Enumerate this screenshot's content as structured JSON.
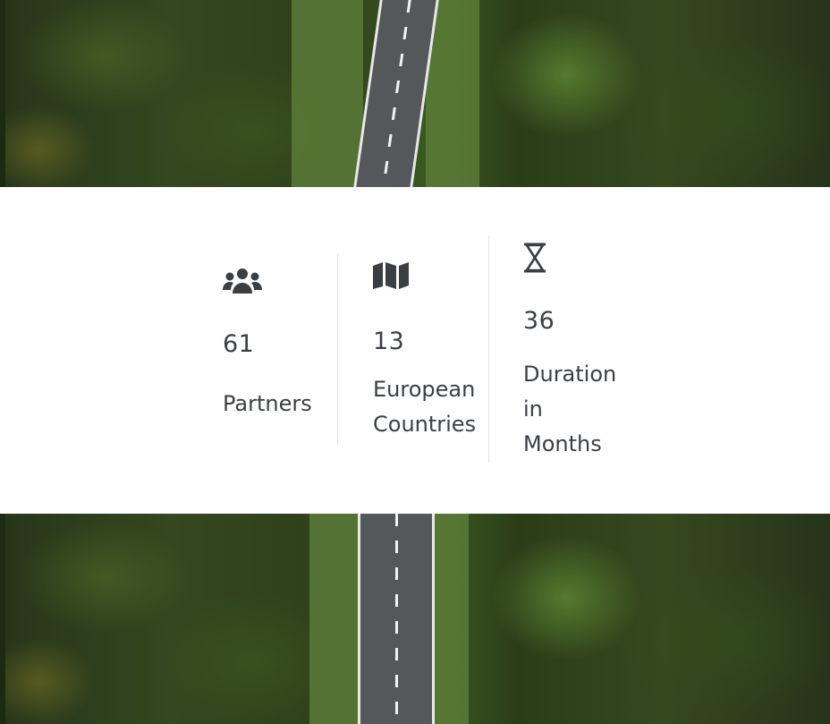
{
  "stats": [
    {
      "icon": "users-group-icon",
      "value": "61",
      "label_lines": [
        "Partners"
      ]
    },
    {
      "icon": "map-icon",
      "value": "13",
      "label_lines": [
        "European",
        "Countries"
      ]
    },
    {
      "icon": "hourglass-icon",
      "value": "36",
      "label_lines": [
        "Duration",
        "in",
        "Months"
      ]
    }
  ],
  "colors": {
    "text": "#3b3f44",
    "divider": "#e1e3e5",
    "band": "#ffffff"
  }
}
